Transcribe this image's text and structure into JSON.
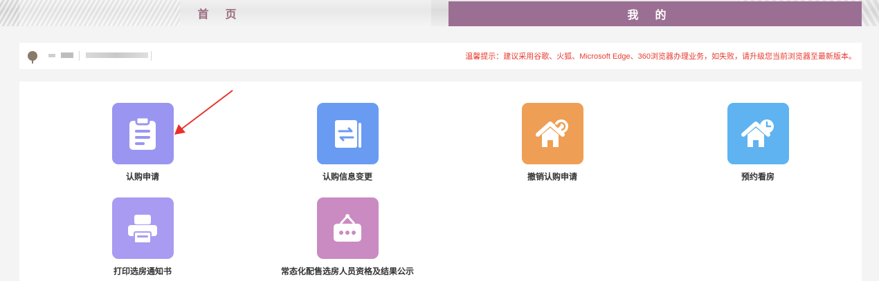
{
  "nav": {
    "home_label": "首页",
    "mine_label": "我的",
    "mine_bg": "#9b6f93"
  },
  "notice": "温馨提示：建议采用谷歌、火狐、Microsoft Edge、360浏览器办理业务，如失败，请升级您当前浏览器至最新版本。",
  "notice_color": "#e83a2f",
  "menu": [
    {
      "label": "认购申请",
      "icon": "clipboard-icon",
      "color": "#9a95f0"
    },
    {
      "label": "认购信息变更",
      "icon": "document-exchange-icon",
      "color": "#6a9bf3"
    },
    {
      "label": "撤销认购申请",
      "icon": "house-undo-icon",
      "color": "#ee9f55"
    },
    {
      "label": "预约看房",
      "icon": "house-clock-icon",
      "color": "#5eb3f0"
    },
    {
      "label": "打印选房通知书",
      "icon": "printer-icon",
      "color": "#a99bf2"
    },
    {
      "label": "常态化配售选房人员资格及结果公示",
      "icon": "notice-board-icon",
      "color": "#c98bc1"
    }
  ]
}
